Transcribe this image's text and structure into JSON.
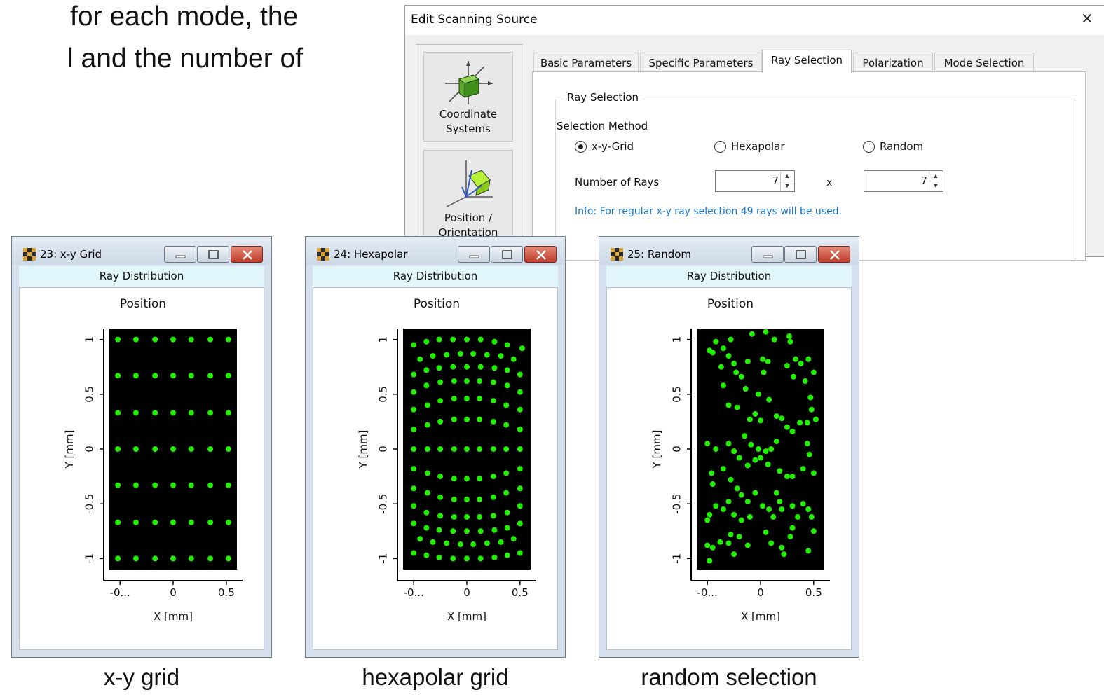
{
  "slide": {
    "line1": "for each mode, the",
    "line2": "l and the number of",
    "captions": [
      "x-y grid",
      "hexapolar grid",
      "random selection"
    ]
  },
  "dialog": {
    "title": "Edit Scanning Source",
    "close_symbol": "×",
    "nav": [
      {
        "label_line1": "Coordinate",
        "label_line2": "Systems",
        "icon": "coordinate-systems-icon"
      },
      {
        "label_line1": "Position /",
        "label_line2": "Orientation",
        "icon": "position-orientation-icon"
      }
    ],
    "tabs": [
      "Basic Parameters",
      "Specific Parameters",
      "Ray Selection",
      "Polarization",
      "Mode Selection"
    ],
    "active_tab": "Ray Selection",
    "group_title": "Ray Selection",
    "selection_method_label": "Selection Method",
    "radios": [
      {
        "label": "x-y-Grid",
        "checked": true
      },
      {
        "label": "Hexapolar",
        "checked": false
      },
      {
        "label": "Random",
        "checked": false
      }
    ],
    "number_of_rays_label": "Number of Rays",
    "rays_x": "7",
    "times_symbol": "x",
    "rays_y": "7",
    "info": "Info: For regular x-y ray selection 49 rays will be used."
  },
  "windows": [
    {
      "title": "23: x-y Grid",
      "header": "Ray Distribution"
    },
    {
      "title": "24: Hexapolar",
      "header": "Ray Distribution"
    },
    {
      "title": "25: Random",
      "header": "Ray Distribution"
    }
  ],
  "colors": {
    "point": "#22ee00",
    "plot_bg": "#000000",
    "info_text": "#1a78c9"
  },
  "chart_data": [
    {
      "type": "scatter",
      "title": "Position",
      "xlabel": "X [mm]",
      "ylabel": "Y [mm]",
      "x_ticks": [
        "-0...",
        "0",
        "0.5"
      ],
      "y_ticks": [
        "-1",
        "-0.5",
        "0",
        "0.5",
        "1"
      ],
      "xlim": [
        -0.6,
        0.6
      ],
      "ylim": [
        -1.1,
        1.1
      ],
      "x_tick_values": [
        -0.5,
        0,
        0.5
      ],
      "y_tick_values": [
        -1,
        -0.5,
        0,
        0.5,
        1
      ],
      "points": [
        [
          -0.52,
          1.0
        ],
        [
          -0.35,
          1.0
        ],
        [
          -0.17,
          1.0
        ],
        [
          0.0,
          1.0
        ],
        [
          0.17,
          1.0
        ],
        [
          0.35,
          1.0
        ],
        [
          0.52,
          1.0
        ],
        [
          -0.52,
          0.67
        ],
        [
          -0.35,
          0.67
        ],
        [
          -0.17,
          0.67
        ],
        [
          0.0,
          0.67
        ],
        [
          0.17,
          0.67
        ],
        [
          0.35,
          0.67
        ],
        [
          0.52,
          0.67
        ],
        [
          -0.52,
          0.33
        ],
        [
          -0.35,
          0.33
        ],
        [
          -0.17,
          0.33
        ],
        [
          0.0,
          0.33
        ],
        [
          0.17,
          0.33
        ],
        [
          0.35,
          0.33
        ],
        [
          0.52,
          0.33
        ],
        [
          -0.52,
          0.0
        ],
        [
          -0.35,
          0.0
        ],
        [
          -0.17,
          0.0
        ],
        [
          0.0,
          0.0
        ],
        [
          0.17,
          0.0
        ],
        [
          0.35,
          0.0
        ],
        [
          0.52,
          0.0
        ],
        [
          -0.52,
          -0.33
        ],
        [
          -0.35,
          -0.33
        ],
        [
          -0.17,
          -0.33
        ],
        [
          0.0,
          -0.33
        ],
        [
          0.17,
          -0.33
        ],
        [
          0.35,
          -0.33
        ],
        [
          0.52,
          -0.33
        ],
        [
          -0.52,
          -0.67
        ],
        [
          -0.35,
          -0.67
        ],
        [
          -0.17,
          -0.67
        ],
        [
          0.0,
          -0.67
        ],
        [
          0.17,
          -0.67
        ],
        [
          0.35,
          -0.67
        ],
        [
          0.52,
          -0.67
        ],
        [
          -0.52,
          -1.0
        ],
        [
          -0.35,
          -1.0
        ],
        [
          -0.17,
          -1.0
        ],
        [
          0.0,
          -1.0
        ],
        [
          0.17,
          -1.0
        ],
        [
          0.35,
          -1.0
        ],
        [
          0.52,
          -1.0
        ]
      ]
    },
    {
      "type": "scatter",
      "title": "Position",
      "xlabel": "X [mm]",
      "ylabel": "Y [mm]",
      "x_ticks": [
        "-0...",
        "0",
        "0.5"
      ],
      "y_ticks": [
        "-1",
        "-0.5",
        "0",
        "0.5",
        "1"
      ],
      "xlim": [
        -0.6,
        0.6
      ],
      "ylim": [
        -1.1,
        1.1
      ],
      "x_tick_values": [
        -0.5,
        0,
        0.5
      ],
      "y_tick_values": [
        -1,
        -0.5,
        0,
        0.5,
        1
      ],
      "points": [
        [
          -0.5,
          0.95
        ],
        [
          -0.38,
          0.98
        ],
        [
          -0.26,
          1.0
        ],
        [
          -0.13,
          1.0
        ],
        [
          0.0,
          1.0
        ],
        [
          0.13,
          1.0
        ],
        [
          0.26,
          0.98
        ],
        [
          0.38,
          0.95
        ],
        [
          0.52,
          0.92
        ],
        [
          -0.44,
          0.82
        ],
        [
          -0.32,
          0.85
        ],
        [
          -0.19,
          0.86
        ],
        [
          -0.06,
          0.87
        ],
        [
          0.06,
          0.87
        ],
        [
          0.19,
          0.86
        ],
        [
          0.32,
          0.85
        ],
        [
          0.44,
          0.82
        ],
        [
          -0.5,
          0.68
        ],
        [
          -0.38,
          0.72
        ],
        [
          -0.26,
          0.74
        ],
        [
          -0.13,
          0.75
        ],
        [
          0.0,
          0.75
        ],
        [
          0.13,
          0.75
        ],
        [
          0.26,
          0.74
        ],
        [
          0.38,
          0.72
        ],
        [
          0.5,
          0.68
        ],
        [
          -0.5,
          0.52
        ],
        [
          -0.38,
          0.58
        ],
        [
          -0.25,
          0.61
        ],
        [
          -0.12,
          0.62
        ],
        [
          0.0,
          0.62
        ],
        [
          0.12,
          0.62
        ],
        [
          0.25,
          0.61
        ],
        [
          0.38,
          0.58
        ],
        [
          0.5,
          0.52
        ],
        [
          -0.5,
          0.36
        ],
        [
          -0.37,
          0.4
        ],
        [
          -0.25,
          0.44
        ],
        [
          -0.12,
          0.46
        ],
        [
          0.0,
          0.46
        ],
        [
          0.12,
          0.46
        ],
        [
          0.25,
          0.44
        ],
        [
          0.37,
          0.4
        ],
        [
          0.5,
          0.36
        ],
        [
          -0.5,
          0.18
        ],
        [
          -0.37,
          0.22
        ],
        [
          -0.25,
          0.25
        ],
        [
          -0.12,
          0.27
        ],
        [
          0.0,
          0.27
        ],
        [
          0.12,
          0.27
        ],
        [
          0.25,
          0.25
        ],
        [
          0.37,
          0.22
        ],
        [
          0.5,
          0.18
        ],
        [
          -0.5,
          0.0
        ],
        [
          -0.37,
          0.0
        ],
        [
          -0.25,
          0.0
        ],
        [
          -0.12,
          0.0
        ],
        [
          0.0,
          0.0
        ],
        [
          0.12,
          0.0
        ],
        [
          0.25,
          0.0
        ],
        [
          0.37,
          0.0
        ],
        [
          0.5,
          0.0
        ],
        [
          -0.5,
          -0.18
        ],
        [
          -0.37,
          -0.22
        ],
        [
          -0.25,
          -0.25
        ],
        [
          -0.12,
          -0.27
        ],
        [
          0.0,
          -0.27
        ],
        [
          0.12,
          -0.27
        ],
        [
          0.25,
          -0.25
        ],
        [
          0.37,
          -0.22
        ],
        [
          0.5,
          -0.18
        ],
        [
          -0.5,
          -0.36
        ],
        [
          -0.37,
          -0.4
        ],
        [
          -0.25,
          -0.44
        ],
        [
          -0.12,
          -0.46
        ],
        [
          0.0,
          -0.46
        ],
        [
          0.12,
          -0.46
        ],
        [
          0.25,
          -0.44
        ],
        [
          0.37,
          -0.4
        ],
        [
          0.5,
          -0.36
        ],
        [
          -0.5,
          -0.52
        ],
        [
          -0.38,
          -0.58
        ],
        [
          -0.25,
          -0.61
        ],
        [
          -0.12,
          -0.62
        ],
        [
          0.0,
          -0.62
        ],
        [
          0.12,
          -0.62
        ],
        [
          0.25,
          -0.61
        ],
        [
          0.38,
          -0.58
        ],
        [
          0.5,
          -0.52
        ],
        [
          -0.5,
          -0.68
        ],
        [
          -0.38,
          -0.72
        ],
        [
          -0.26,
          -0.74
        ],
        [
          -0.13,
          -0.75
        ],
        [
          0.0,
          -0.75
        ],
        [
          0.13,
          -0.75
        ],
        [
          0.26,
          -0.74
        ],
        [
          0.38,
          -0.72
        ],
        [
          0.5,
          -0.68
        ],
        [
          -0.44,
          -0.82
        ],
        [
          -0.32,
          -0.85
        ],
        [
          -0.19,
          -0.86
        ],
        [
          -0.06,
          -0.87
        ],
        [
          0.06,
          -0.87
        ],
        [
          0.19,
          -0.86
        ],
        [
          0.32,
          -0.85
        ],
        [
          0.44,
          -0.82
        ],
        [
          -0.5,
          -0.95
        ],
        [
          -0.38,
          -0.97
        ],
        [
          -0.26,
          -0.99
        ],
        [
          -0.13,
          -1.0
        ],
        [
          0.0,
          -1.0
        ],
        [
          0.13,
          -1.0
        ],
        [
          0.26,
          -0.99
        ],
        [
          0.38,
          -0.97
        ],
        [
          0.5,
          -0.95
        ]
      ]
    },
    {
      "type": "scatter",
      "title": "Position",
      "xlabel": "X [mm]",
      "ylabel": "Y [mm]",
      "x_ticks": [
        "-0...",
        "0",
        "0.5"
      ],
      "y_ticks": [
        "-1",
        "-0.5",
        "0",
        "0.5",
        "1"
      ],
      "xlim": [
        -0.6,
        0.6
      ],
      "ylim": [
        -1.1,
        1.1
      ],
      "x_tick_values": [
        -0.5,
        0,
        0.5
      ],
      "y_tick_values": [
        -1,
        -0.5,
        0,
        0.5,
        1
      ],
      "points": [
        [
          -0.42,
          0.98
        ],
        [
          -0.28,
          1.0
        ],
        [
          -0.08,
          1.05
        ],
        [
          0.05,
          1.07
        ],
        [
          0.13,
          1.0
        ],
        [
          0.27,
          1.03
        ],
        [
          0.28,
          0.98
        ],
        [
          -0.35,
          0.92
        ],
        [
          -0.45,
          0.88
        ],
        [
          -0.48,
          0.9
        ],
        [
          -0.3,
          0.85
        ],
        [
          -0.25,
          0.78
        ],
        [
          -0.12,
          0.8
        ],
        [
          0.02,
          0.82
        ],
        [
          0.07,
          0.8
        ],
        [
          0.33,
          0.82
        ],
        [
          0.45,
          0.82
        ],
        [
          0.38,
          0.78
        ],
        [
          -0.37,
          0.75
        ],
        [
          -0.23,
          0.7
        ],
        [
          -0.18,
          0.66
        ],
        [
          0.03,
          0.7
        ],
        [
          0.25,
          0.76
        ],
        [
          0.31,
          0.66
        ],
        [
          0.42,
          0.62
        ],
        [
          0.5,
          0.7
        ],
        [
          -0.35,
          0.58
        ],
        [
          -0.14,
          0.55
        ],
        [
          -0.02,
          0.5
        ],
        [
          0.08,
          0.45
        ],
        [
          0.47,
          0.47
        ],
        [
          -0.3,
          0.4
        ],
        [
          -0.22,
          0.38
        ],
        [
          -0.05,
          0.32
        ],
        [
          -0.1,
          0.27
        ],
        [
          0.0,
          0.26
        ],
        [
          0.15,
          0.3
        ],
        [
          0.2,
          0.28
        ],
        [
          0.25,
          0.2
        ],
        [
          0.3,
          0.16
        ],
        [
          0.37,
          0.24
        ],
        [
          0.44,
          0.24
        ],
        [
          0.52,
          0.27
        ],
        [
          0.48,
          0.36
        ],
        [
          -0.5,
          0.05
        ],
        [
          -0.42,
          0.0
        ],
        [
          -0.3,
          0.05
        ],
        [
          -0.25,
          -0.02
        ],
        [
          -0.15,
          0.12
        ],
        [
          -0.09,
          0.04
        ],
        [
          -0.02,
          0.0
        ],
        [
          0.05,
          -0.02
        ],
        [
          0.15,
          0.07
        ],
        [
          0.1,
          0.0
        ],
        [
          -0.2,
          -0.08
        ],
        [
          -0.12,
          -0.15
        ],
        [
          -0.05,
          -0.1
        ],
        [
          0.0,
          -0.08
        ],
        [
          0.07,
          -0.14
        ],
        [
          0.18,
          -0.2
        ],
        [
          0.25,
          -0.25
        ],
        [
          0.3,
          -0.25
        ],
        [
          0.4,
          -0.18
        ],
        [
          0.46,
          -0.05
        ],
        [
          0.44,
          0.05
        ],
        [
          0.5,
          -0.22
        ],
        [
          -0.46,
          -0.22
        ],
        [
          -0.45,
          -0.32
        ],
        [
          -0.35,
          -0.18
        ],
        [
          -0.28,
          -0.28
        ],
        [
          -0.22,
          -0.36
        ],
        [
          -0.18,
          -0.42
        ],
        [
          -0.12,
          -0.48
        ],
        [
          -0.05,
          -0.4
        ],
        [
          0.02,
          -0.52
        ],
        [
          0.08,
          -0.55
        ],
        [
          0.12,
          -0.62
        ],
        [
          -0.3,
          -0.48
        ],
        [
          -0.35,
          -0.55
        ],
        [
          -0.25,
          -0.6
        ],
        [
          -0.18,
          -0.65
        ],
        [
          -0.1,
          -0.62
        ],
        [
          -0.42,
          -0.52
        ],
        [
          -0.48,
          -0.6
        ],
        [
          -0.5,
          -0.65
        ],
        [
          0.15,
          -0.4
        ],
        [
          0.18,
          -0.48
        ],
        [
          0.2,
          -0.55
        ],
        [
          0.3,
          -0.52
        ],
        [
          0.4,
          -0.5
        ],
        [
          0.45,
          -0.55
        ],
        [
          0.48,
          -0.62
        ],
        [
          0.35,
          -0.62
        ],
        [
          0.3,
          -0.72
        ],
        [
          -0.28,
          -0.78
        ],
        [
          -0.2,
          -0.8
        ],
        [
          -0.12,
          -0.88
        ],
        [
          0.05,
          -0.76
        ],
        [
          0.1,
          -0.86
        ],
        [
          0.2,
          -0.9
        ],
        [
          0.28,
          -0.8
        ],
        [
          0.22,
          -0.96
        ],
        [
          -0.38,
          -0.85
        ],
        [
          -0.45,
          -0.9
        ],
        [
          -0.5,
          -0.88
        ],
        [
          -0.3,
          -0.86
        ],
        [
          -0.25,
          -0.96
        ],
        [
          0.5,
          -0.75
        ],
        [
          0.45,
          -0.93
        ],
        [
          -0.48,
          -1.02
        ]
      ]
    }
  ]
}
